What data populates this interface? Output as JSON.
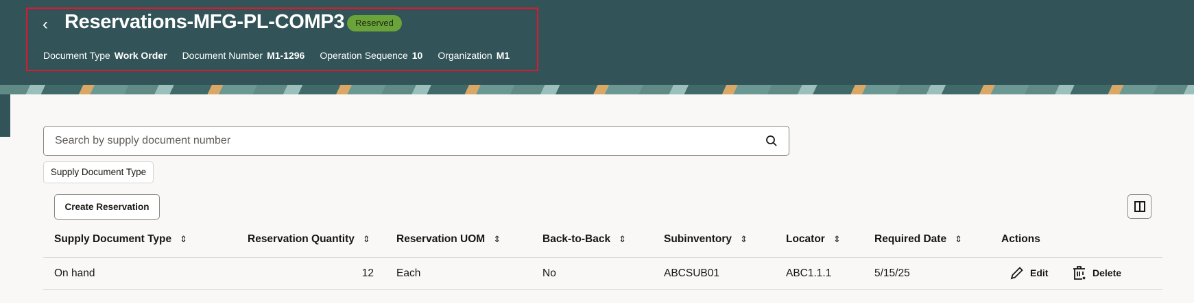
{
  "header": {
    "title": "Reservations-MFG-PL-COMP3",
    "status": "Reserved",
    "meta": [
      {
        "label": "Document Type",
        "value": "Work Order"
      },
      {
        "label": "Document Number",
        "value": "M1-1296"
      },
      {
        "label": "Operation Sequence",
        "value": "10"
      },
      {
        "label": "Organization",
        "value": "M1"
      }
    ]
  },
  "search": {
    "placeholder": "Search by supply document number"
  },
  "filter_chip": "Supply Document Type",
  "create_button": "Create Reservation",
  "table": {
    "columns": [
      "Supply Document Type",
      "Reservation Quantity",
      "Reservation UOM",
      "Back-to-Back",
      "Subinventory",
      "Locator",
      "Required Date",
      "Actions"
    ],
    "rows": [
      {
        "type": "On hand",
        "qty": "12",
        "uom": "Each",
        "b2b": "No",
        "subinv": "ABCSUB01",
        "locator": "ABC1.1.1",
        "date": "5/15/25",
        "edit": "Edit",
        "delete": "Delete"
      }
    ]
  },
  "colors": {
    "header_bg": "#325357",
    "badge": "#6aa33a"
  }
}
